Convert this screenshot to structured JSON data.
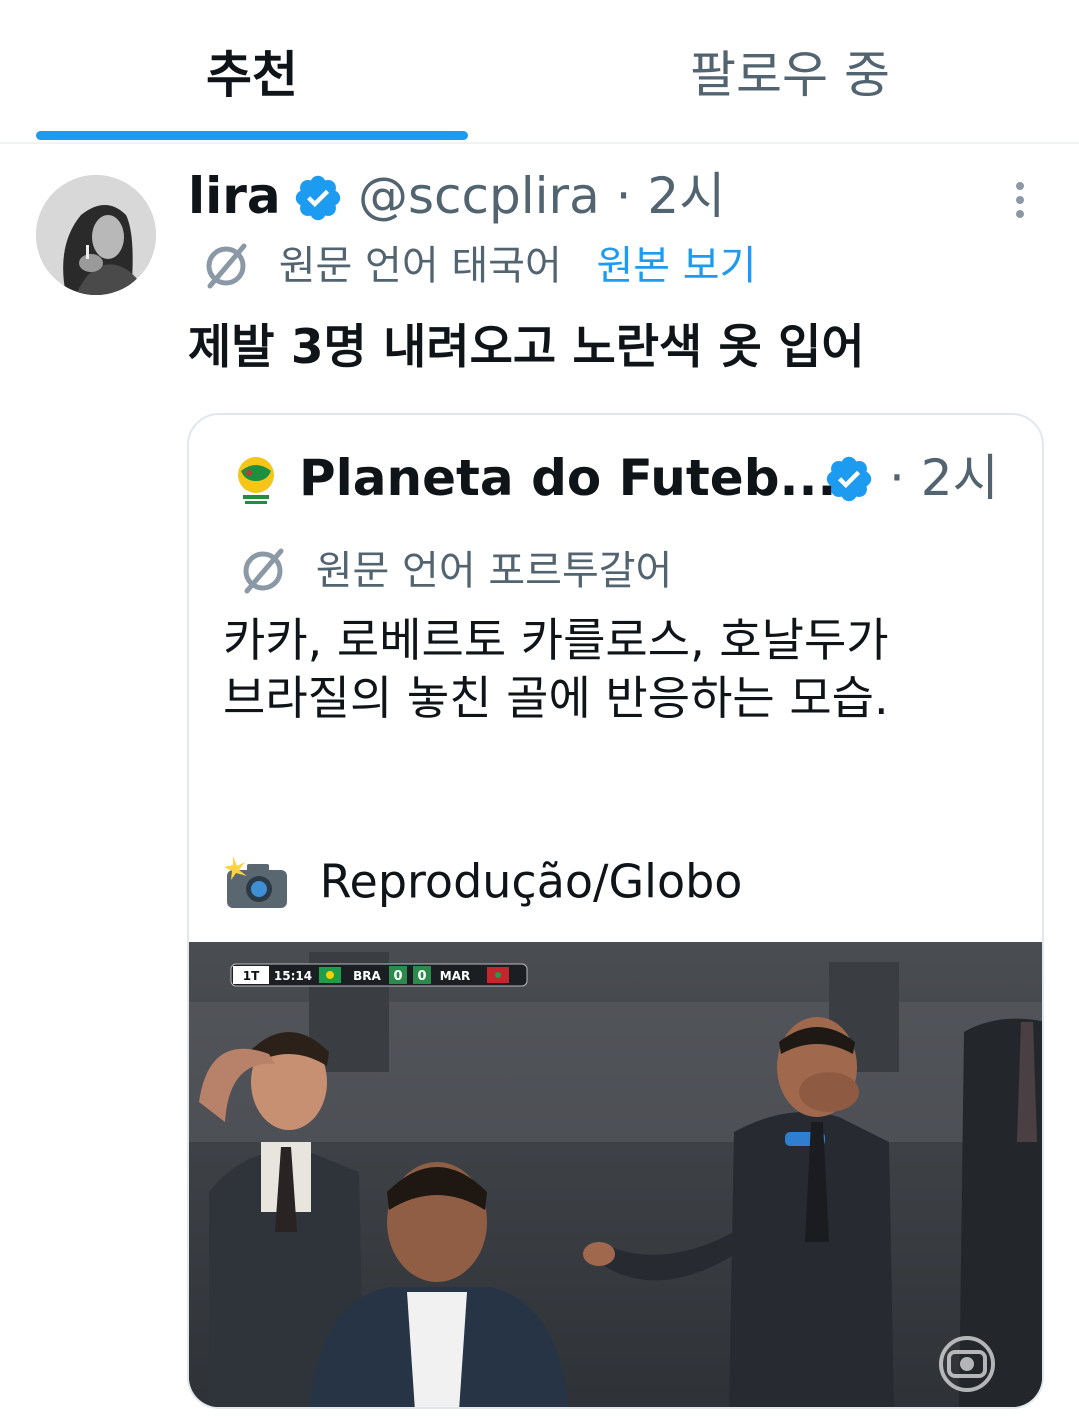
{
  "tabs": {
    "recommended": "추천",
    "following": "팔로우 중"
  },
  "tweet": {
    "display_name": "lira",
    "handle_time": "@sccplira · 2시",
    "translate": {
      "source_language": "원문 언어 태국어",
      "show_original": "원본 보기"
    },
    "text": "제발 3명 내려오고 노란색 옷 입어"
  },
  "quote": {
    "display_name": "Planeta do Futeb...",
    "time": "· 2시",
    "translate": {
      "source_language": "원문 언어 포르투갈어"
    },
    "body_lines": [
      "카카, 로베르토 카를로스, 호날두가",
      "브라질의 놓친 골에 반응하는 모습."
    ],
    "credit": "Reprodução/Globo",
    "media": {
      "score_bug": {
        "period": "1T",
        "clock": "15:14",
        "home": "BRA",
        "home_score": "0",
        "away_score": "0",
        "away": "MAR"
      },
      "broadcaster": "globo"
    }
  },
  "colors": {
    "accent": "#1d9bf0",
    "secondary_text": "#536471",
    "primary_text": "#0f1419",
    "divider": "#eff3f4"
  }
}
